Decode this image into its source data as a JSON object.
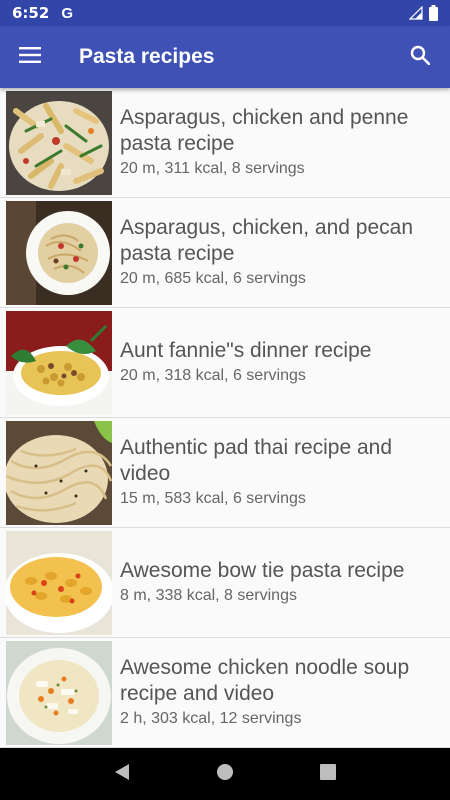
{
  "status_bar": {
    "time": "6:52",
    "g_label": "G"
  },
  "app_bar": {
    "title": "Pasta recipes",
    "icons": [
      "menu-icon",
      "search-icon"
    ]
  },
  "recipes": [
    {
      "title": "Asparagus, chicken and penne pasta recipe",
      "meta": "20 m, 311 kcal, 8 servings"
    },
    {
      "title": "Asparagus, chicken, and pecan pasta recipe",
      "meta": "20 m, 685 kcal, 6 servings"
    },
    {
      "title": "Aunt fannie\"s dinner recipe",
      "meta": "20 m, 318 kcal, 6 servings"
    },
    {
      "title": "Authentic pad thai recipe and video",
      "meta": "15 m, 583 kcal, 6 servings"
    },
    {
      "title": "Awesome bow tie pasta recipe",
      "meta": "8 m, 338 kcal, 8 servings"
    },
    {
      "title": "Awesome chicken noodle soup recipe and video",
      "meta": "2 h, 303 kcal, 12 servings"
    }
  ],
  "nav_bar": {
    "icons": [
      "back-icon",
      "home-icon",
      "recents-icon"
    ]
  },
  "colors": {
    "status_bar": "#3146a8",
    "app_bar": "#3f51b5",
    "background": "#fafafa"
  }
}
